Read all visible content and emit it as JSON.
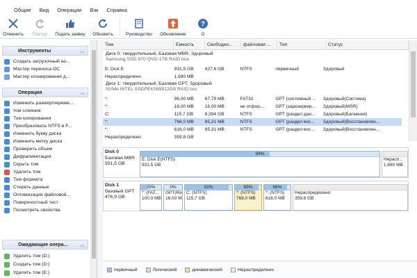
{
  "menu": [
    "Общие",
    "Вид",
    "Операции",
    "Вэк",
    "Справка"
  ],
  "toolbar": [
    {
      "label": "Отменить",
      "icon": "undo-icon",
      "disabled": false
    },
    {
      "label": "Повтор",
      "icon": "redo-icon",
      "disabled": true
    },
    {
      "label": "Подать заявку",
      "icon": "thumbs-up-icon",
      "disabled": false
    },
    {
      "label": "Обновить",
      "icon": "refresh-icon",
      "disabled": false
    },
    {
      "label": "Руководство",
      "icon": "book-icon",
      "disabled": false
    },
    {
      "label": "Обновление",
      "icon": "upgrade-icon",
      "disabled": false
    },
    {
      "label": "О",
      "icon": "help-icon",
      "disabled": false
    }
  ],
  "sidebar": {
    "sections": [
      {
        "title": "Инструменты",
        "items": [
          "Создать загрузочный но...",
          "Мастер переноса ОС",
          "Мастер клонирования д..."
        ]
      },
      {
        "title": "Операция",
        "items": [
          "Изменить размер/переме...",
          "том слияния",
          "Том копирования",
          "Преобразовать NTFS в F...",
          "Изменить букву диска",
          "Изменить метку диска",
          "Проверить объем",
          "Дефрагментация",
          "Скрыть том",
          "Удалить том",
          "Том формата",
          "Стереть данные",
          "Оптимизация файловой...",
          "Поверхностный тест",
          "Посмотреть свойства"
        ]
      },
      {
        "title": "Ожидающие опера...",
        "items": [
          "Удалить том (D:)",
          "Создать том (D:)",
          "Удалить том (E:)"
        ]
      }
    ]
  },
  "table": {
    "columns": [
      "Том",
      "Емкость",
      "Свободно...",
      "файловая ...",
      "Тип",
      "Статус"
    ],
    "disk0_header": "Диск 0: твердотельный, Базовая MBR, Здоровый",
    "disk0_model": "Samsung SSD 870 QVO 1TB RAID bus",
    "disk0_rows": [
      [
        "E: Disk E",
        "931,5 GB",
        "427,6 GB",
        "NTFS",
        "первичный",
        "Здоровый"
      ],
      [
        "Нераспределено",
        "1,680 MB",
        "",
        "",
        "",
        ""
      ]
    ],
    "disk1_header": "Диск 1: твердотельный, Базовая GPT, Здоровый",
    "disk1_model": "NVMe INTEL SSDPEKNW512G8 RAID bus",
    "disk1_rows": [
      [
        "*:",
        "96,00 MB",
        "67,79 MB",
        "FAT32",
        "GPT (системный ...",
        "Здоровый(Система)"
      ],
      [
        "*:",
        "16,00 MB",
        "16,00 MB",
        "не отфор...",
        "GPT (зарезервир...",
        "Здоровый(MSR)"
      ],
      [
        "C:",
        "115,7 GB",
        "9,394 GB",
        "NTFS",
        "GPT (раздел дан...",
        "Здоровый(Багажник)"
      ],
      [
        "*:",
        "768,0 MB",
        "85,31 MB",
        "NTFS",
        "GPT (раздел вос...",
        "Здоровый(Восстановлен..."
      ],
      [
        "*:",
        "616,0 MB",
        "85,31 MB",
        "NTFS",
        "GPT (раздел вос...",
        "Здоровый(Восстановлен..."
      ],
      [
        "Нераспределено",
        "359,8 GB",
        "",
        "",
        "",
        ""
      ]
    ],
    "selected_row": 3
  },
  "disk0_map": {
    "name": "Disk 0",
    "type": "Базовая MBR",
    "size": "931,5 GB",
    "parts": [
      {
        "pct": "94%",
        "used": 0.54,
        "name": "E: Disk E(NTFS)",
        "size": "931,5 GB"
      },
      {
        "pct": "",
        "used": 0,
        "name": "Нерасп...",
        "size": "1,680 MB",
        "unalloc": true
      }
    ]
  },
  "disk1_map": {
    "name": "Disk 1",
    "type": "базовый GPT",
    "size": "476,9 GB",
    "parts": [
      {
        "pct": "29%",
        "used": 0.29,
        "name": "*: (FAT...",
        "size": "100,0 MB"
      },
      {
        "pct": "0%",
        "used": 0.0,
        "name": "GPT(Re...",
        "size": "16,00 MB"
      },
      {
        "pct": "92%",
        "used": 0.92,
        "name": "C: (NTFS)",
        "size": "115,7 GB"
      },
      {
        "pct": "89%",
        "used": 0.89,
        "name": "*: (NTFS)",
        "size": "768,0 MB",
        "selected": true
      },
      {
        "pct": "86%",
        "used": 0.86,
        "name": "*: (NTFS)",
        "size": "616,0 MB"
      },
      {
        "pct": "",
        "used": 0,
        "name": "Нераспределено",
        "size": "359,8 GB",
        "unalloc": true
      }
    ]
  },
  "legend": [
    {
      "label": "первичный",
      "color": "#9cc2ea"
    },
    {
      "label": "Логический",
      "color": "#c3e9c0"
    },
    {
      "label": "динамический",
      "color": "#e7e0a0"
    },
    {
      "label": "Нераспределено",
      "color": "#ececec"
    }
  ]
}
